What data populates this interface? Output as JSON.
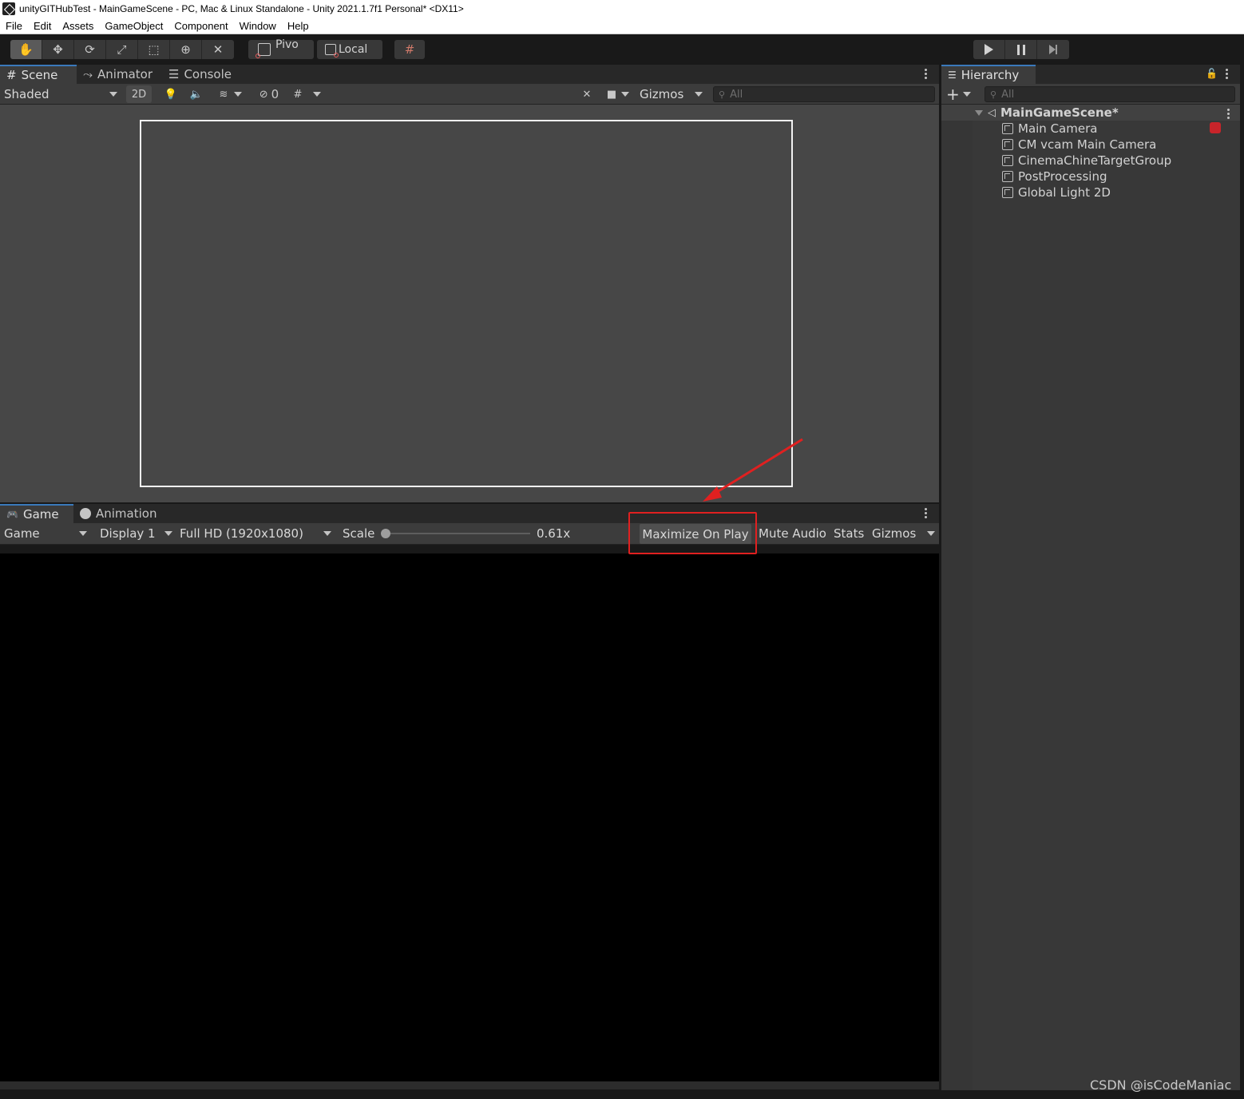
{
  "window": {
    "title": "unityGITHubTest - MainGameScene - PC, Mac & Linux Standalone - Unity 2021.1.7f1 Personal* <DX11>"
  },
  "menu": [
    "File",
    "Edit",
    "Assets",
    "GameObject",
    "Component",
    "Window",
    "Help"
  ],
  "toolbar": {
    "tools": [
      "hand-tool-icon",
      "move-tool-icon",
      "rotate-tool-icon",
      "scale-tool-icon",
      "rect-tool-icon",
      "transform-tool-icon",
      "custom-tool-icon"
    ],
    "pivot_label": "Pivo",
    "local_label": "Local"
  },
  "scene_panel": {
    "tabs": [
      {
        "label": "Scene",
        "icon": "hash-icon"
      },
      {
        "label": "Animator",
        "icon": "animator-icon"
      },
      {
        "label": "Console",
        "icon": "console-icon"
      }
    ],
    "shading_mode": "Shaded",
    "mode_2d": "2D",
    "hidden_count": "0",
    "gizmos_label": "Gizmos",
    "search_placeholder": "All"
  },
  "game_panel": {
    "tabs": [
      {
        "label": "Game",
        "icon": "gamepad-icon"
      },
      {
        "label": "Animation",
        "icon": "clock-icon"
      }
    ],
    "view_mode": "Game",
    "display": "Display 1",
    "resolution": "Full HD (1920x1080)",
    "scale_label": "Scale",
    "scale_value": "0.61x",
    "maximize_label": "Maximize On Play",
    "mute_label": "Mute Audio",
    "stats_label": "Stats",
    "gizmos_label": "Gizmos"
  },
  "hierarchy": {
    "tab_label": "Hierarchy",
    "search_placeholder": "All",
    "scene_name": "MainGameScene*",
    "items": [
      "Main Camera",
      "CM vcam Main Camera",
      "CinemaChineTargetGroup",
      "PostProcessing",
      "Global Light 2D"
    ]
  },
  "watermark": "CSDN @isCodeManiac",
  "colors": {
    "annotation_red": "#e02020",
    "active_tab_accent": "#3a79bb"
  }
}
